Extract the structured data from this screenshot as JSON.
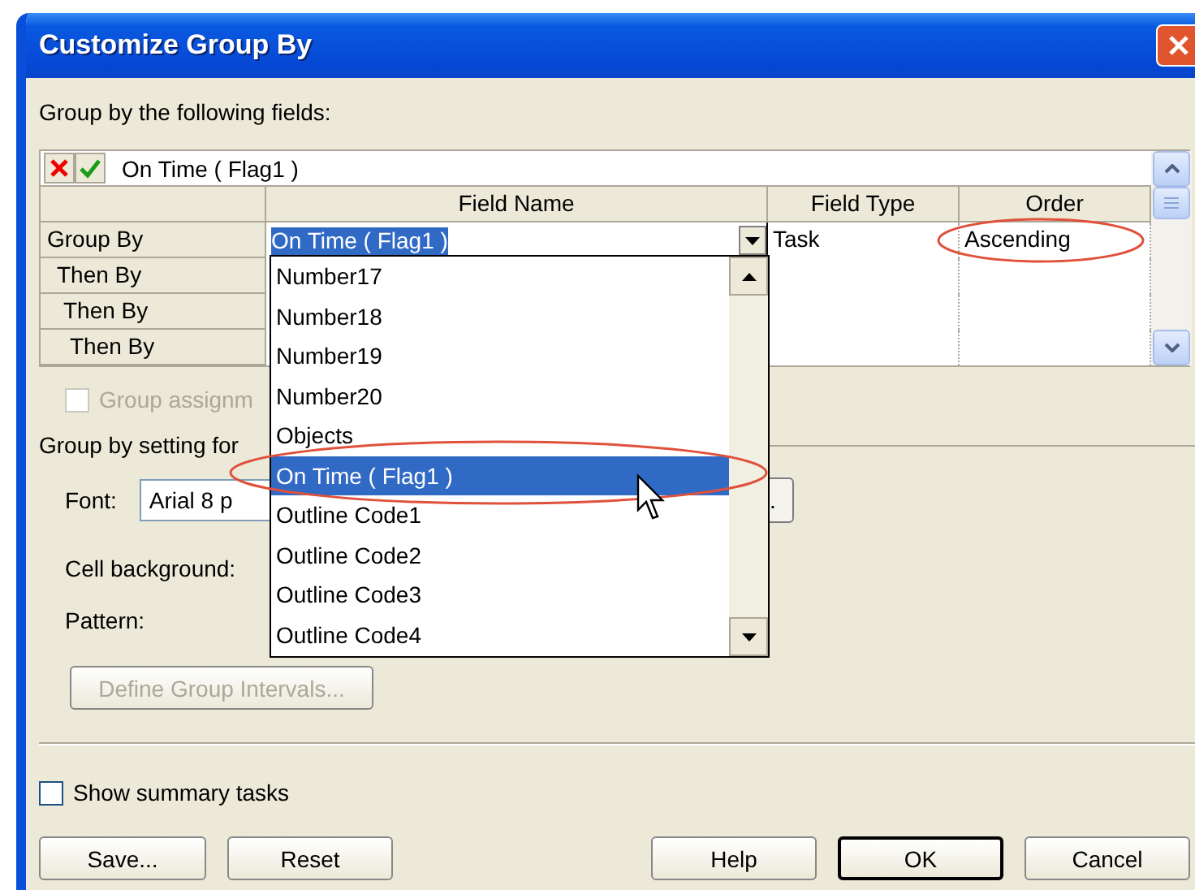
{
  "window": {
    "title": "Customize Group By"
  },
  "fields_label": "Group by the following fields:",
  "edit_bar": {
    "value": "On Time ( Flag1 )"
  },
  "grid": {
    "columns": [
      "Field Name",
      "Field Type",
      "Order"
    ],
    "rows": [
      {
        "label": "Group By",
        "field_name": "On Time ( Flag1 )",
        "field_type": "Task",
        "order": "Ascending"
      },
      {
        "label": "Then By"
      },
      {
        "label": "Then By"
      },
      {
        "label": "Then By"
      }
    ]
  },
  "dropdown": {
    "items": [
      {
        "label": "Number17",
        "selected": false
      },
      {
        "label": "Number18",
        "selected": false
      },
      {
        "label": "Number19",
        "selected": false
      },
      {
        "label": "Number20",
        "selected": false
      },
      {
        "label": "Objects",
        "selected": false
      },
      {
        "label": "On Time ( Flag1 )",
        "selected": true
      },
      {
        "label": "Outline Code1",
        "selected": false
      },
      {
        "label": "Outline Code2",
        "selected": false
      },
      {
        "label": "Outline Code3",
        "selected": false
      },
      {
        "label": "Outline Code4",
        "selected": false
      }
    ]
  },
  "group_assignments": {
    "label": "Group assignm",
    "checked": false,
    "disabled": true
  },
  "settings_label": "Group by setting for",
  "font": {
    "label": "Font:",
    "value": "Arial 8 p",
    "button": "."
  },
  "cell_background": {
    "label": "Cell background:"
  },
  "pattern": {
    "label": "Pattern:"
  },
  "define_intervals": {
    "label": "Define Group Intervals...",
    "disabled": true
  },
  "show_summary": {
    "label": "Show summary tasks",
    "checked": false
  },
  "buttons": [
    {
      "label": "Save...",
      "default": false
    },
    {
      "label": "Reset",
      "default": false
    },
    {
      "label": "Help",
      "default": false
    },
    {
      "label": "OK",
      "default": true
    },
    {
      "label": "Cancel",
      "default": false
    }
  ]
}
